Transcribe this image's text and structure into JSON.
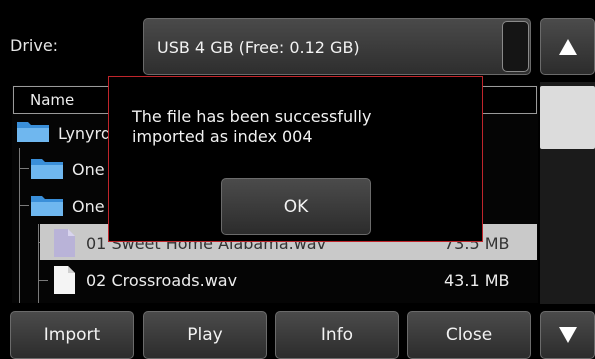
{
  "drive": {
    "label": "Drive:",
    "value": "USB 4 GB (Free: 0.12 GB)"
  },
  "list": {
    "column_name": "Name",
    "items": [
      {
        "kind": "folder",
        "label": "Lynyrd"
      },
      {
        "kind": "folder",
        "label": "One"
      },
      {
        "kind": "folder",
        "label": "One"
      },
      {
        "kind": "file",
        "label": "01 Sweet Home Alabama.wav",
        "size": "73.5 MB",
        "selected": true
      },
      {
        "kind": "file",
        "label": "02 Crossroads.wav",
        "size": "43.1 MB",
        "selected": false
      }
    ]
  },
  "dialog": {
    "message": "The file has been successfully\nimported as index 004",
    "ok_label": "OK",
    "border_color": "#c0252b"
  },
  "buttons": {
    "import": "Import",
    "play": "Play",
    "info": "Info",
    "close": "Close"
  },
  "icons": {
    "scroll_up": "triangle-up-icon",
    "scroll_down": "triangle-down-icon",
    "folder": "folder-icon",
    "file": "file-icon"
  }
}
